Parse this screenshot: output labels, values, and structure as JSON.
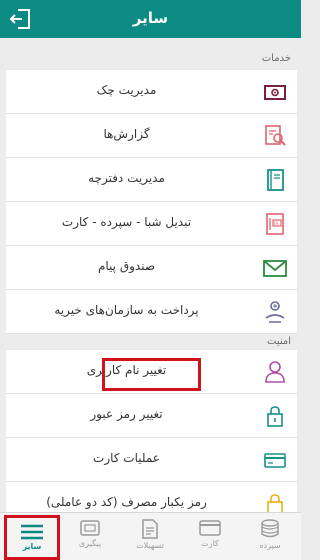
{
  "header": {
    "title": "سایر"
  },
  "sections": {
    "services_title": "خدمات",
    "security_title": "امنیت"
  },
  "services": [
    {
      "label": "مدیریت چک"
    },
    {
      "label": "گزارش‌ها"
    },
    {
      "label": "مدیریت دفترچه"
    },
    {
      "label": "تبدیل شبا - سپرده - کارت"
    },
    {
      "label": "صندوق پیام"
    },
    {
      "label": "پرداخت به سازمان‌های خیریه"
    }
  ],
  "security": [
    {
      "label": "تغییر نام کاربری"
    },
    {
      "label": "تغییر رمز عبور"
    },
    {
      "label": "عملیات کارت"
    },
    {
      "label": "رمز یکبار مصرف (کد دو عاملی)"
    }
  ],
  "tabs": [
    {
      "label": "سایر"
    },
    {
      "label": "پیگیری"
    },
    {
      "label": "تسهیلات"
    },
    {
      "label": "کارت"
    },
    {
      "label": "سپرده"
    }
  ],
  "colors": {
    "accent": "#0c8a84",
    "highlight": "#d0121b"
  }
}
